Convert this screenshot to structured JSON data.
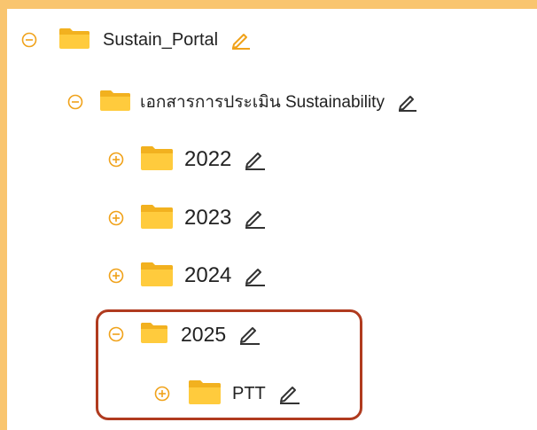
{
  "colors": {
    "accent_orange": "#f9c56f",
    "folder_yellow": "#ffcb3d",
    "folder_tab": "#f2b11f",
    "highlight_border": "#b03b1f",
    "icon_pencil_dark": "#333333",
    "icon_pencil_orange": "#f0a21a"
  },
  "tree": {
    "root": {
      "label": "Sustain_Portal",
      "toggle": "collapse-icon",
      "edit_icon": "pencil-icon"
    },
    "child": {
      "label": "เอกสารการประเมิน Sustainability",
      "toggle": "collapse-icon",
      "edit_icon": "pencil-icon"
    },
    "years": [
      {
        "label": "2022",
        "toggle": "expand-icon",
        "edit_icon": "pencil-icon"
      },
      {
        "label": "2023",
        "toggle": "expand-icon",
        "edit_icon": "pencil-icon"
      },
      {
        "label": "2024",
        "toggle": "expand-icon",
        "edit_icon": "pencil-icon"
      },
      {
        "label": "2025",
        "toggle": "collapse-icon",
        "edit_icon": "pencil-icon"
      }
    ],
    "ptt": {
      "label": "PTT",
      "toggle": "expand-icon",
      "edit_icon": "pencil-icon"
    }
  }
}
